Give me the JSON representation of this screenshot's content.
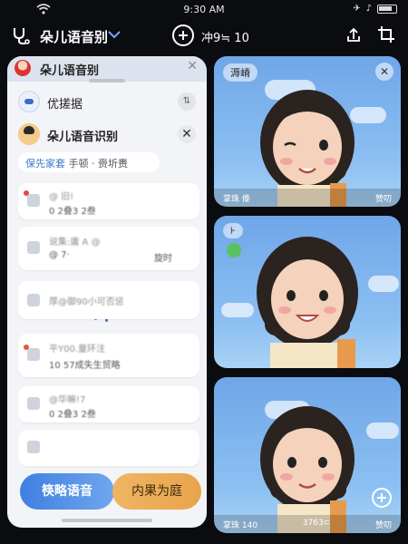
{
  "status_bar": {
    "time": "9:30 AM"
  },
  "toolbar": {
    "title": "朵儿语音别",
    "counter": "冲9≒ 10"
  },
  "panel": {
    "header_title": "朵儿语音别",
    "top_label": "优搓据",
    "main_label": "朵儿语音识别",
    "hint_link": "保先家套",
    "hint_text": "手顿 · 赍圻赉",
    "cards": [
      {
        "line1": "@ 旧!",
        "line2": "0 2叠3 2叁"
      },
      {
        "line1": "说集:庸 A   @",
        "line2": "@ 7·",
        "side": "旋时"
      },
      {
        "line1": "厚@御90小可否惩",
        "line2": ""
      },
      {
        "line1": "平Y00.童环注",
        "line2": "10 57成失生贸略"
      },
      {
        "line1": "@华嘛!7",
        "line2": "0 2叠3 2叁"
      },
      {
        "line1": "",
        "line2": ""
      }
    ],
    "btn_voice": "筷略语音",
    "btn_result": "内果为庭"
  },
  "cards_right": [
    {
      "tag": "溽嵴",
      "footer_left": "掌珠 傣",
      "footer_right": "赞叨"
    },
    {
      "tag": "⊦",
      "footer_left": "",
      "footer_right": ""
    },
    {
      "tag": "",
      "footer_left": "掌珠 140",
      "footer_mid": "3763⊂",
      "footer_right": "赞叨"
    }
  ]
}
